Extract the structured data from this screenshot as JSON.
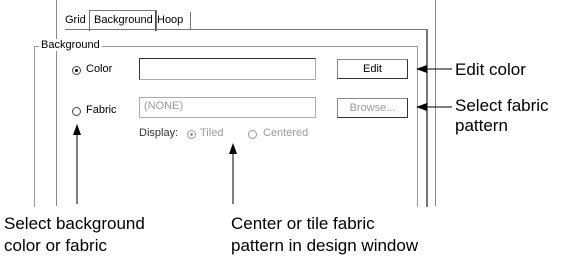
{
  "tabs": [
    "Grid",
    "Background",
    "Hoop"
  ],
  "group_title": "Background",
  "color_option": {
    "label": "Color",
    "value": "",
    "button": "Edit"
  },
  "fabric_option": {
    "label": "Fabric",
    "value": "(NONE)",
    "button": "Browse..."
  },
  "display": {
    "label": "Display:",
    "options": [
      "Tiled",
      "Centered"
    ],
    "selected": "Tiled"
  },
  "callouts": {
    "edit_color": "Edit color",
    "select_fabric": [
      "Select fabric",
      "pattern"
    ],
    "select_background": [
      "Select background",
      "color or fabric"
    ],
    "center_tile": [
      "Center or tile fabric",
      "pattern in design window"
    ]
  }
}
